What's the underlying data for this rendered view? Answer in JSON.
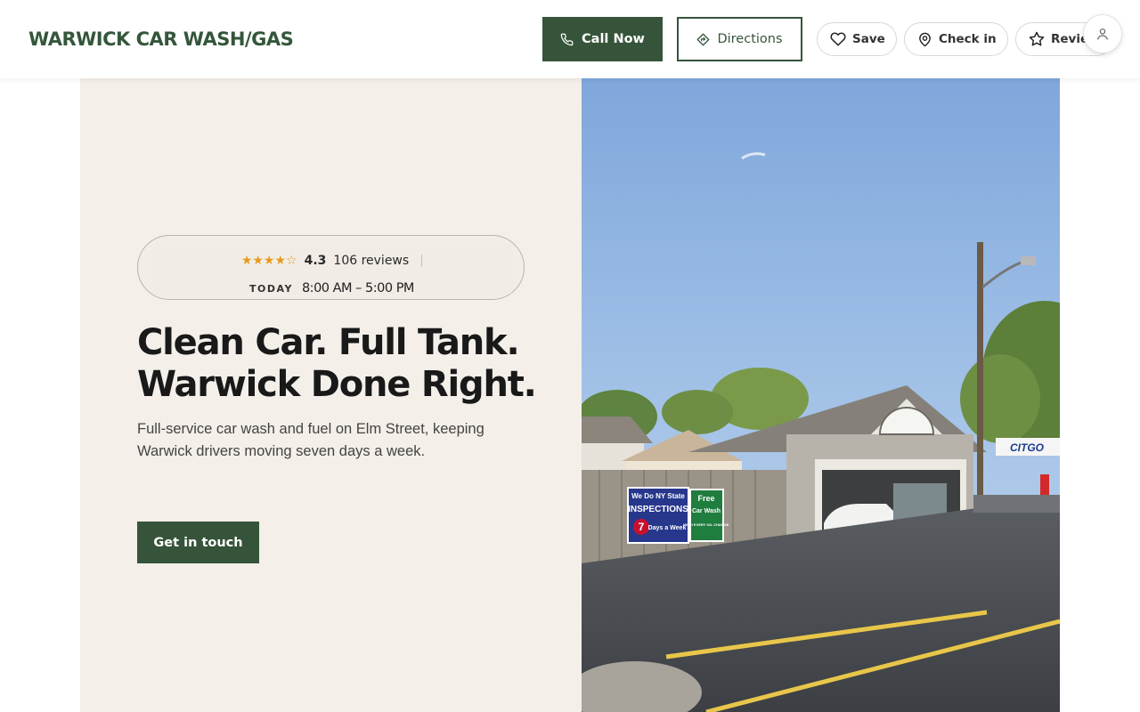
{
  "header": {
    "brand": "WARWICK CAR WASH/GAS",
    "call_label": "Call Now",
    "directions_label": "Directions",
    "save_label": "Save",
    "checkin_label": "Check in",
    "review_label": "Review"
  },
  "hero": {
    "rating": {
      "value": "4.3",
      "stars": 4.3,
      "reviews": "106 reviews",
      "today_label": "TODAY",
      "hours": "8:00 AM – 5:00 PM"
    },
    "headline_line1": "Clean Car. Full Tank.",
    "headline_line2": "Warwick Done Right.",
    "subcopy": "Full-service car wash and fuel on Elm Street, keeping Warwick drivers moving seven days a week.",
    "cta_label": "Get in touch",
    "photo": {
      "sign1_line1": "We Do NY State",
      "sign1_line2": "INSPECTIONS",
      "sign1_line3": "Days a Week",
      "sign1_number": "7",
      "sign2_line1": "Free",
      "sign2_line2": "Car Wash",
      "sign2_line3": "WITH EVERY OIL CHANGE",
      "citgo": "CITGO"
    }
  },
  "colors": {
    "brand_green": "#36543a",
    "hero_bg": "#f4efe9",
    "star": "#e79b1c"
  },
  "icons": {
    "call": "phone-icon",
    "directions": "directions-icon",
    "save": "heart-icon",
    "checkin": "map-pin-icon",
    "review": "star-icon",
    "account": "user-icon"
  }
}
